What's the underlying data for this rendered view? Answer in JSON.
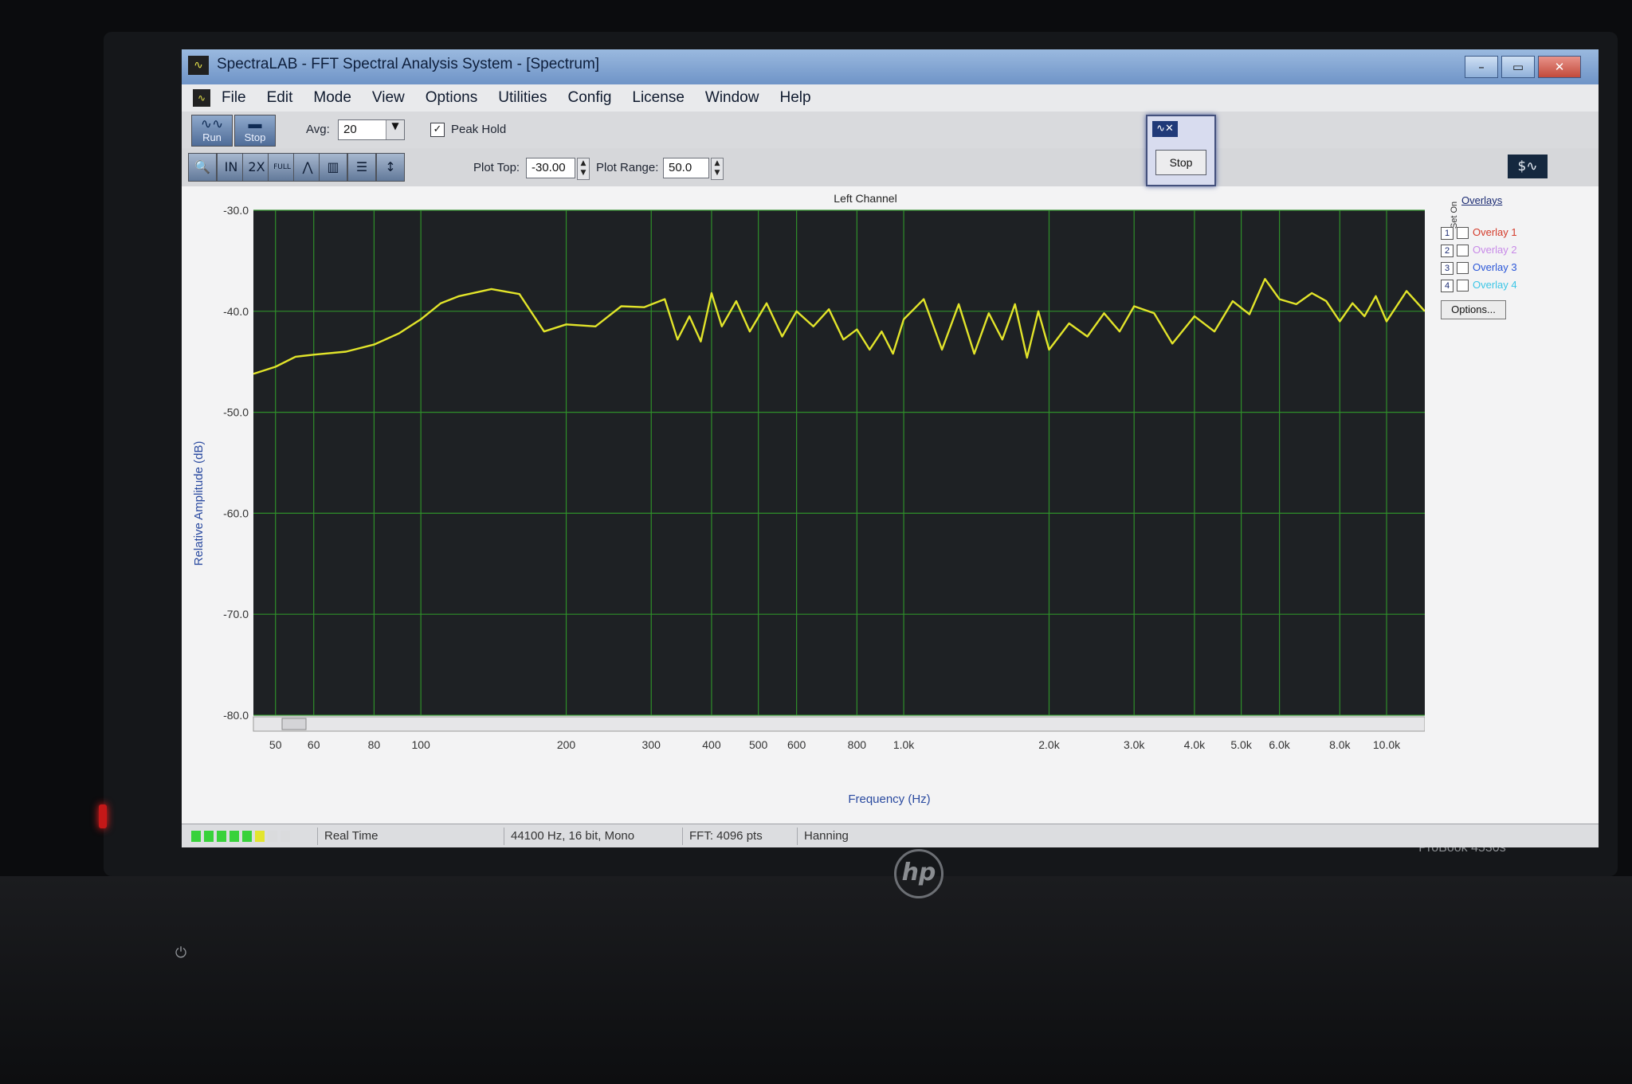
{
  "window": {
    "title": "SpectraLAB - FFT Spectral Analysis System - [Spectrum]",
    "controls": [
      "–",
      "▭",
      "✕"
    ]
  },
  "menu": [
    "File",
    "Edit",
    "Mode",
    "View",
    "Options",
    "Utilities",
    "Config",
    "License",
    "Window",
    "Help"
  ],
  "toolbar": {
    "run_label": "Run",
    "stop_label": "Stop",
    "avg_label": "Avg:",
    "avg_value": "20",
    "peak_hold_label": "Peak Hold",
    "peak_hold_checked": true,
    "icon_buttons": [
      {
        "name": "zoom-icon",
        "glyph": "🔍"
      },
      {
        "name": "in-2x-icon",
        "glyph": "IN"
      },
      {
        "name": "out-2x-icon",
        "glyph": "2X"
      },
      {
        "name": "out-full-icon",
        "glyph": "FULL"
      },
      {
        "name": "line-plot-icon",
        "glyph": "⋀"
      },
      {
        "name": "bar-plot-icon",
        "glyph": "▥"
      },
      {
        "name": "table-icon",
        "glyph": "☰"
      },
      {
        "name": "cursor-icon",
        "glyph": "↕"
      }
    ],
    "plot_top_label": "Plot Top:",
    "plot_top_value": "-30.00",
    "plot_range_label": "Plot Range:",
    "plot_range_value": "50.0"
  },
  "float_control": {
    "stop_label": "Stop"
  },
  "overlays": {
    "title": "Overlays",
    "set_on_label": "Set On",
    "items": [
      {
        "num": "1",
        "label": "Overlay 1",
        "color": "#d43b2a"
      },
      {
        "num": "2",
        "label": "Overlay 2",
        "color": "#c88ae8"
      },
      {
        "num": "3",
        "label": "Overlay 3",
        "color": "#2b57d8"
      },
      {
        "num": "4",
        "label": "Overlay 4",
        "color": "#3cc6e6"
      }
    ],
    "options_label": "Options..."
  },
  "chart_data": {
    "type": "line",
    "title": "Left Channel",
    "xlabel": "Frequency (Hz)",
    "ylabel": "Relative Amplitude (dB)",
    "x_scale": "log",
    "xlim": [
      45,
      12000
    ],
    "ylim": [
      -80,
      -30
    ],
    "y_ticks": [
      "-30.0",
      "-40.0",
      "-50.0",
      "-60.0",
      "-70.0",
      "-80.0"
    ],
    "x_ticks": [
      {
        "v": 50,
        "label": "50"
      },
      {
        "v": 60,
        "label": "60"
      },
      {
        "v": 80,
        "label": "80"
      },
      {
        "v": 100,
        "label": "100"
      },
      {
        "v": 200,
        "label": "200"
      },
      {
        "v": 300,
        "label": "300"
      },
      {
        "v": 400,
        "label": "400"
      },
      {
        "v": 500,
        "label": "500"
      },
      {
        "v": 600,
        "label": "600"
      },
      {
        "v": 800,
        "label": "800"
      },
      {
        "v": 1000,
        "label": "1.0k"
      },
      {
        "v": 2000,
        "label": "2.0k"
      },
      {
        "v": 3000,
        "label": "3.0k"
      },
      {
        "v": 4000,
        "label": "4.0k"
      },
      {
        "v": 5000,
        "label": "5.0k"
      },
      {
        "v": 6000,
        "label": "6.0k"
      },
      {
        "v": 8000,
        "label": "8.0k"
      },
      {
        "v": 10000,
        "label": "10.0k"
      }
    ],
    "grid": true,
    "background": "#1e2124",
    "grid_color": "#2f8f2a",
    "series": [
      {
        "color": "#e2e42a",
        "x": [
          45,
          50,
          55,
          60,
          70,
          80,
          90,
          100,
          110,
          120,
          140,
          160,
          180,
          200,
          230,
          260,
          290,
          320,
          340,
          360,
          380,
          400,
          420,
          450,
          480,
          520,
          560,
          600,
          650,
          700,
          750,
          800,
          850,
          900,
          950,
          1000,
          1100,
          1200,
          1300,
          1400,
          1500,
          1600,
          1700,
          1800,
          1900,
          2000,
          2200,
          2400,
          2600,
          2800,
          3000,
          3300,
          3600,
          4000,
          4400,
          4800,
          5200,
          5600,
          6000,
          6500,
          7000,
          7500,
          8000,
          8500,
          9000,
          9500,
          10000,
          11000,
          12000
        ],
        "y": [
          -46.2,
          -45.5,
          -44.5,
          -44.3,
          -44.0,
          -43.3,
          -42.2,
          -40.8,
          -39.2,
          -38.5,
          -37.8,
          -38.3,
          -42.0,
          -41.3,
          -41.5,
          -39.5,
          -39.6,
          -38.8,
          -42.8,
          -40.5,
          -43.0,
          -38.2,
          -41.5,
          -39.0,
          -42.0,
          -39.2,
          -42.5,
          -40.0,
          -41.5,
          -39.8,
          -42.8,
          -41.8,
          -43.8,
          -42.0,
          -44.2,
          -40.8,
          -38.8,
          -43.8,
          -39.3,
          -44.2,
          -40.2,
          -42.8,
          -39.3,
          -44.6,
          -40.0,
          -43.8,
          -41.2,
          -42.5,
          -40.2,
          -42.0,
          -39.5,
          -40.2,
          -43.2,
          -40.5,
          -42.0,
          -39.0,
          -40.3,
          -36.8,
          -38.8,
          -39.3,
          -38.2,
          -39.0,
          -41.0,
          -39.2,
          -40.5,
          -38.5,
          -41.0,
          -38.0,
          -40.0
        ]
      }
    ]
  },
  "status": {
    "mode": "Real Time",
    "format": "44100 Hz, 16 bit, Mono",
    "fft": "FFT: 4096 pts",
    "window_fn": "Hanning",
    "meter_level": 0.75
  },
  "laptop": {
    "brand": "hp",
    "model": "ProBook 4530s"
  }
}
